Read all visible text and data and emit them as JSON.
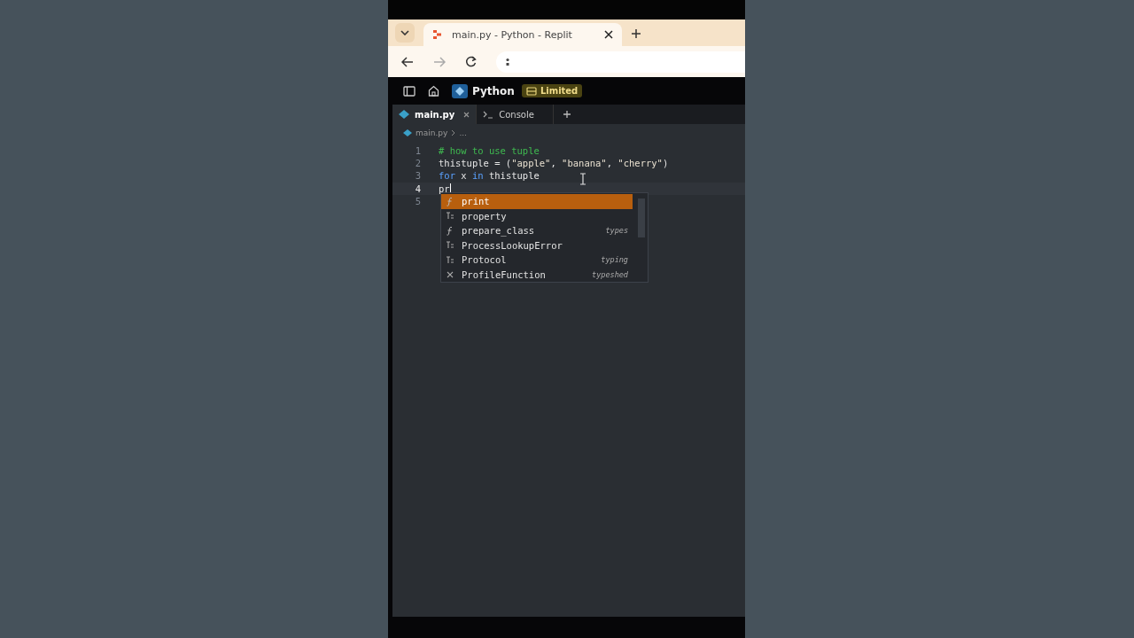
{
  "browser": {
    "tab_title": "main.py - Python - Replit",
    "tab_selected": true
  },
  "app_header": {
    "project": "Python",
    "plan_badge": "Limited"
  },
  "editor_tabs": [
    {
      "label": "main.py",
      "kind": "file",
      "selected": true,
      "closable": true
    },
    {
      "label": "Console",
      "kind": "console",
      "selected": false,
      "closable": false
    }
  ],
  "breadcrumb": {
    "file": "main.py",
    "rest": "..."
  },
  "code_lines": [
    {
      "number": "1",
      "current": false,
      "tokens": [
        {
          "text": "# how to use tuple",
          "kind": "comment"
        }
      ]
    },
    {
      "number": "2",
      "current": false,
      "tokens": [
        {
          "text": "thistuple = (",
          "kind": "plain"
        },
        {
          "text": "\"apple\"",
          "kind": "string"
        },
        {
          "text": ", ",
          "kind": "plain"
        },
        {
          "text": "\"banana\"",
          "kind": "string"
        },
        {
          "text": ", ",
          "kind": "plain"
        },
        {
          "text": "\"cherry\"",
          "kind": "string"
        },
        {
          "text": ")",
          "kind": "plain"
        }
      ]
    },
    {
      "number": "3",
      "current": false,
      "tokens": [
        {
          "text": "for",
          "kind": "keyword"
        },
        {
          "text": " x ",
          "kind": "plain"
        },
        {
          "text": "in",
          "kind": "keyword"
        },
        {
          "text": " thistuple",
          "kind": "plain"
        }
      ]
    },
    {
      "number": "4",
      "current": true,
      "tokens": [
        {
          "text": "pr",
          "kind": "plain"
        }
      ]
    },
    {
      "number": "5",
      "current": false
    }
  ],
  "completions": [
    {
      "label": "print",
      "kind": "function",
      "selected": true
    },
    {
      "label": "property",
      "kind": "class",
      "selected": false
    },
    {
      "label": "prepare_class",
      "kind": "function",
      "detail": "types",
      "selected": false
    },
    {
      "label": "ProcessLookupError",
      "kind": "class",
      "selected": false
    },
    {
      "label": "Protocol",
      "kind": "class",
      "detail": "typing",
      "selected": false
    },
    {
      "label": "ProfileFunction",
      "kind": "variable",
      "detail": "typeshed",
      "selected": false
    }
  ]
}
